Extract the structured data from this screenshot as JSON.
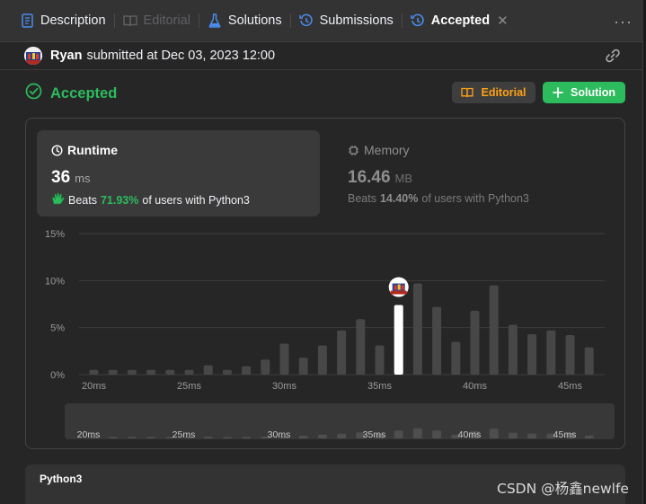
{
  "tabs": [
    {
      "label": "Description",
      "icon": "description-icon",
      "state": "normal"
    },
    {
      "label": "Editorial",
      "icon": "book-icon",
      "state": "dim"
    },
    {
      "label": "Solutions",
      "icon": "flask-icon",
      "state": "normal"
    },
    {
      "label": "Submissions",
      "icon": "history-icon",
      "state": "normal"
    },
    {
      "label": "Accepted",
      "icon": "history-icon",
      "state": "active"
    }
  ],
  "submission": {
    "username": "Ryan",
    "submitted_text": "submitted at Dec 03, 2023 12:00",
    "status": "Accepted"
  },
  "buttons": {
    "editorial": "Editorial",
    "solution": "Solution"
  },
  "runtime": {
    "title": "Runtime",
    "value": "36",
    "unit": "ms",
    "beats_label": "Beats",
    "beats_pct": "71.93%",
    "beats_suffix": "of users with Python3"
  },
  "memory": {
    "title": "Memory",
    "value": "16.46",
    "unit": "MB",
    "beats_label": "Beats",
    "beats_pct": "14.40%",
    "beats_suffix": "of users with Python3"
  },
  "colors": {
    "accent_green": "#2cbb5d",
    "accent_orange": "#ffa116",
    "bar_gray": "#474747",
    "bar_highlight": "#ffffff"
  },
  "chart_data": {
    "type": "bar",
    "ylim": [
      0,
      15
    ],
    "yticks": [
      "15%",
      "10%",
      "5%",
      "0%"
    ],
    "ytick_values": [
      15,
      10,
      5,
      0
    ],
    "xticks": [
      "20ms",
      "25ms",
      "30ms",
      "35ms",
      "40ms",
      "45ms"
    ],
    "xtick_values": [
      20,
      25,
      30,
      35,
      40,
      45
    ],
    "grid": true,
    "values": [
      {
        "x": 20,
        "y": 0.5
      },
      {
        "x": 21,
        "y": 0.5
      },
      {
        "x": 22,
        "y": 0.5
      },
      {
        "x": 23,
        "y": 0.5
      },
      {
        "x": 24,
        "y": 0.5
      },
      {
        "x": 25,
        "y": 0.5
      },
      {
        "x": 26,
        "y": 1.0
      },
      {
        "x": 27,
        "y": 0.5
      },
      {
        "x": 28,
        "y": 0.9
      },
      {
        "x": 29,
        "y": 1.6
      },
      {
        "x": 30,
        "y": 3.3
      },
      {
        "x": 31,
        "y": 1.8
      },
      {
        "x": 32,
        "y": 3.1
      },
      {
        "x": 33,
        "y": 4.7
      },
      {
        "x": 34,
        "y": 5.9
      },
      {
        "x": 35,
        "y": 3.1
      },
      {
        "x": 36,
        "y": 7.4,
        "highlight": true
      },
      {
        "x": 37,
        "y": 9.7
      },
      {
        "x": 38,
        "y": 7.2
      },
      {
        "x": 39,
        "y": 3.5
      },
      {
        "x": 40,
        "y": 6.8
      },
      {
        "x": 41,
        "y": 9.5
      },
      {
        "x": 42,
        "y": 5.3
      },
      {
        "x": 43,
        "y": 4.3
      },
      {
        "x": 44,
        "y": 4.7
      },
      {
        "x": 45,
        "y": 4.2
      },
      {
        "x": 46,
        "y": 2.9
      }
    ],
    "navigator": {
      "xticks": [
        "20ms",
        "25ms",
        "30ms",
        "35ms",
        "40ms",
        "45ms"
      ],
      "values": [
        0.5,
        0.5,
        0.5,
        0.5,
        0.5,
        0.5,
        0.6,
        0.5,
        0.5,
        0.6,
        0.7,
        0.9,
        1.3,
        1.6,
        2.0,
        1.5,
        2.6,
        3.4,
        2.7,
        1.3,
        2.5,
        3.3,
        1.9,
        1.6,
        1.6,
        1.8,
        1.0
      ]
    }
  },
  "code": {
    "language": "Python3"
  },
  "watermark": "CSDN @杨鑫newlfe"
}
